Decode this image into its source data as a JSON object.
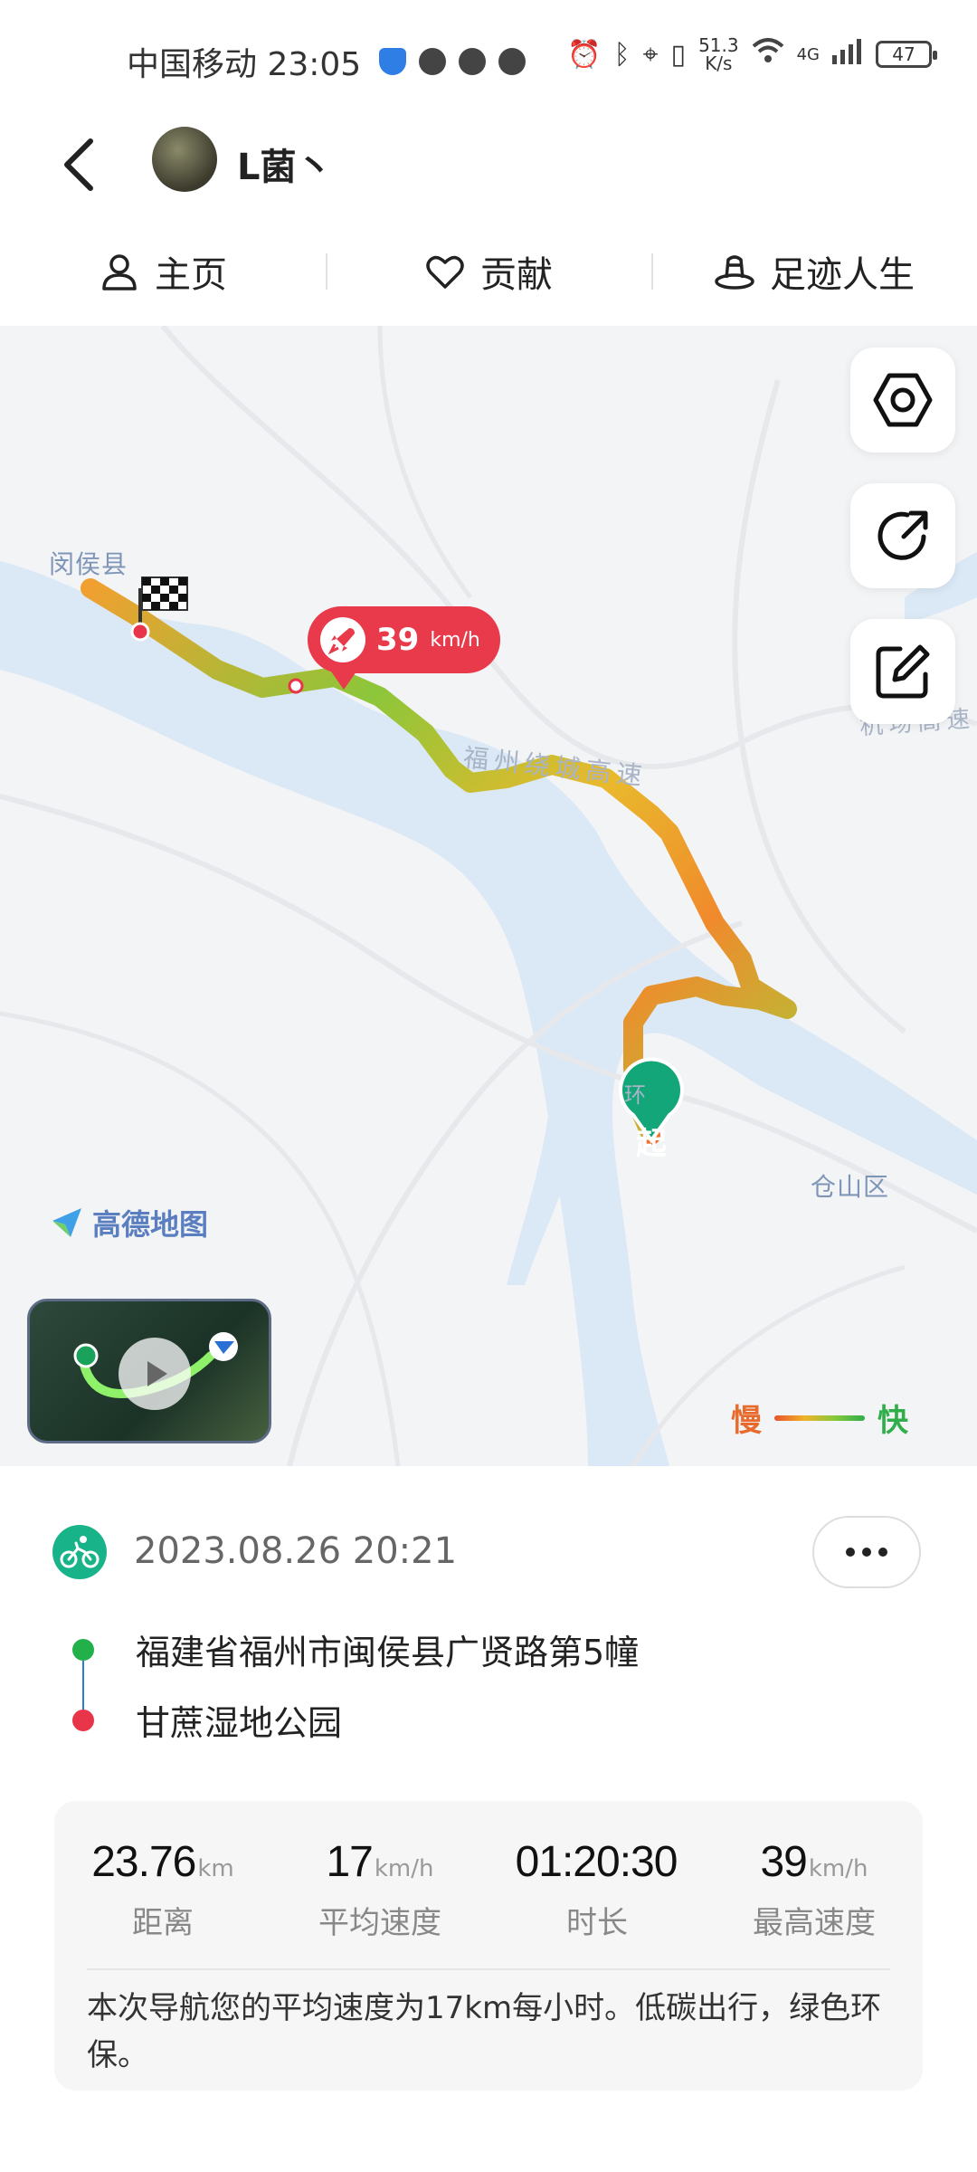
{
  "status_bar": {
    "carrier_time": "中国移动 23:05",
    "net_speed_top": "51.3",
    "net_speed_unit": "K/s",
    "network": "4G",
    "battery": "47"
  },
  "header": {
    "username": "L菌丶"
  },
  "tabs": [
    {
      "label": "主页",
      "icon": "person-icon"
    },
    {
      "label": "贡献",
      "icon": "heart-icon"
    },
    {
      "label": "足迹人生",
      "icon": "footprint-icon"
    }
  ],
  "map": {
    "labels": {
      "minhou": "闵侯县",
      "cangshan": "仓山区",
      "ring_road": "福州绕城高速",
      "airport_road": "机场高速",
      "huan": "环"
    },
    "speed_bubble": {
      "value": "39",
      "unit": "km/h"
    },
    "start_marker": "起",
    "amap_logo": "高德地图",
    "legend": {
      "slow": "慢",
      "fast": "快"
    }
  },
  "trip": {
    "datetime": "2023.08.26 20:21",
    "start_address": "福建省福州市闽侯县广贤路第5幢",
    "end_address": "甘蔗湿地公园",
    "stats": [
      {
        "value": "23.76",
        "unit": "km",
        "label": "距离"
      },
      {
        "value": "17",
        "unit": "km/h",
        "label": "平均速度"
      },
      {
        "value": "01:20:30",
        "unit": "",
        "label": "时长"
      },
      {
        "value": "39",
        "unit": "km/h",
        "label": "最高速度"
      }
    ],
    "summary": "本次导航您的平均速度为17km每小时。低碳出行，绿色环保。"
  },
  "colors": {
    "start_dot": "#22b04a",
    "end_dot": "#e8354a",
    "accent_red": "#e83a4a",
    "ride_icon": "#19b38a"
  }
}
